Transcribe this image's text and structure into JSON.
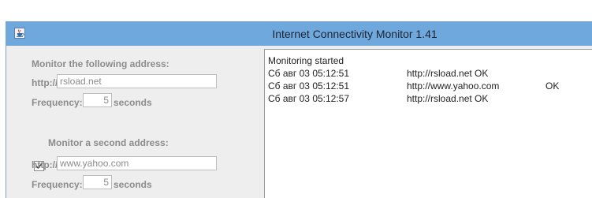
{
  "window": {
    "title": "Internet Connectivity Monitor 1.41",
    "icon": "java-cup-icon"
  },
  "settings": {
    "first": {
      "heading": "Monitor the following address:",
      "address_label": "http://",
      "address_value": "rsload.net",
      "frequency_label": "Frequency:",
      "frequency_value": "5",
      "unit_label": "seconds"
    },
    "second": {
      "heading": "Monitor a second address:",
      "checked": true,
      "address_label": "http://",
      "address_value": "www.yahoo.com",
      "frequency_label": "Frequency:",
      "frequency_value": "5",
      "unit_label": "seconds"
    }
  },
  "log": {
    "lines": [
      {
        "time": "Monitoring started",
        "url": "",
        "status": ""
      },
      {
        "time": "Сб авг 03 05:12:51",
        "url": "http://rsload.net OK",
        "status": ""
      },
      {
        "time": "Сб авг 03 05:12:51",
        "url": "http://www.yahoo.com",
        "status": "OK"
      },
      {
        "time": "Сб авг 03 05:12:57",
        "url": "http://rsload.net OK",
        "status": ""
      }
    ]
  },
  "colors": {
    "titlebar": "#6fa8dc",
    "panel": "#eeeeee",
    "label_gray": "#8c8c8c"
  }
}
